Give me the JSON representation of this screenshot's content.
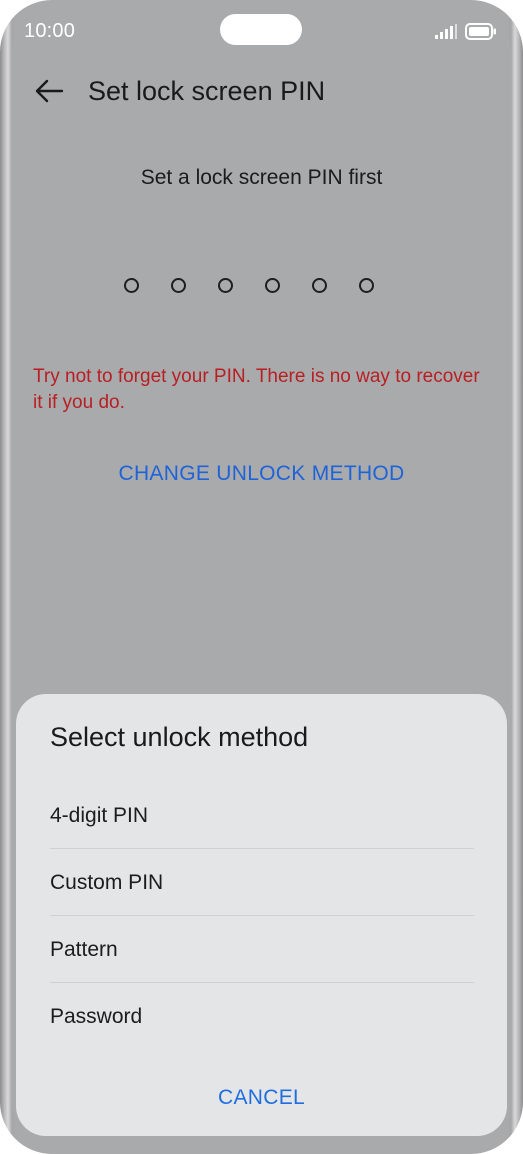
{
  "status_bar": {
    "time": "10:00",
    "signal_icon": "signal-icon",
    "battery_icon": "battery-icon"
  },
  "header": {
    "back_icon": "arrow-left-icon",
    "title": "Set lock screen PIN"
  },
  "main": {
    "prompt": "Set a lock screen PIN first",
    "pin_length": 6,
    "pin_entered": 0,
    "warning": "Try not to forget your PIN. There is no way to recover it if you do.",
    "change_method_link": "CHANGE UNLOCK METHOD"
  },
  "sheet": {
    "title": "Select unlock method",
    "options": [
      {
        "label": "4-digit PIN"
      },
      {
        "label": "Custom PIN"
      },
      {
        "label": "Pattern"
      },
      {
        "label": "Password"
      }
    ],
    "cancel_label": "CANCEL"
  },
  "colors": {
    "warning": "#b81f23",
    "link": "#1f63d8",
    "screen_dim": "#a9aaac",
    "sheet_bg": "#e4e5e7"
  }
}
